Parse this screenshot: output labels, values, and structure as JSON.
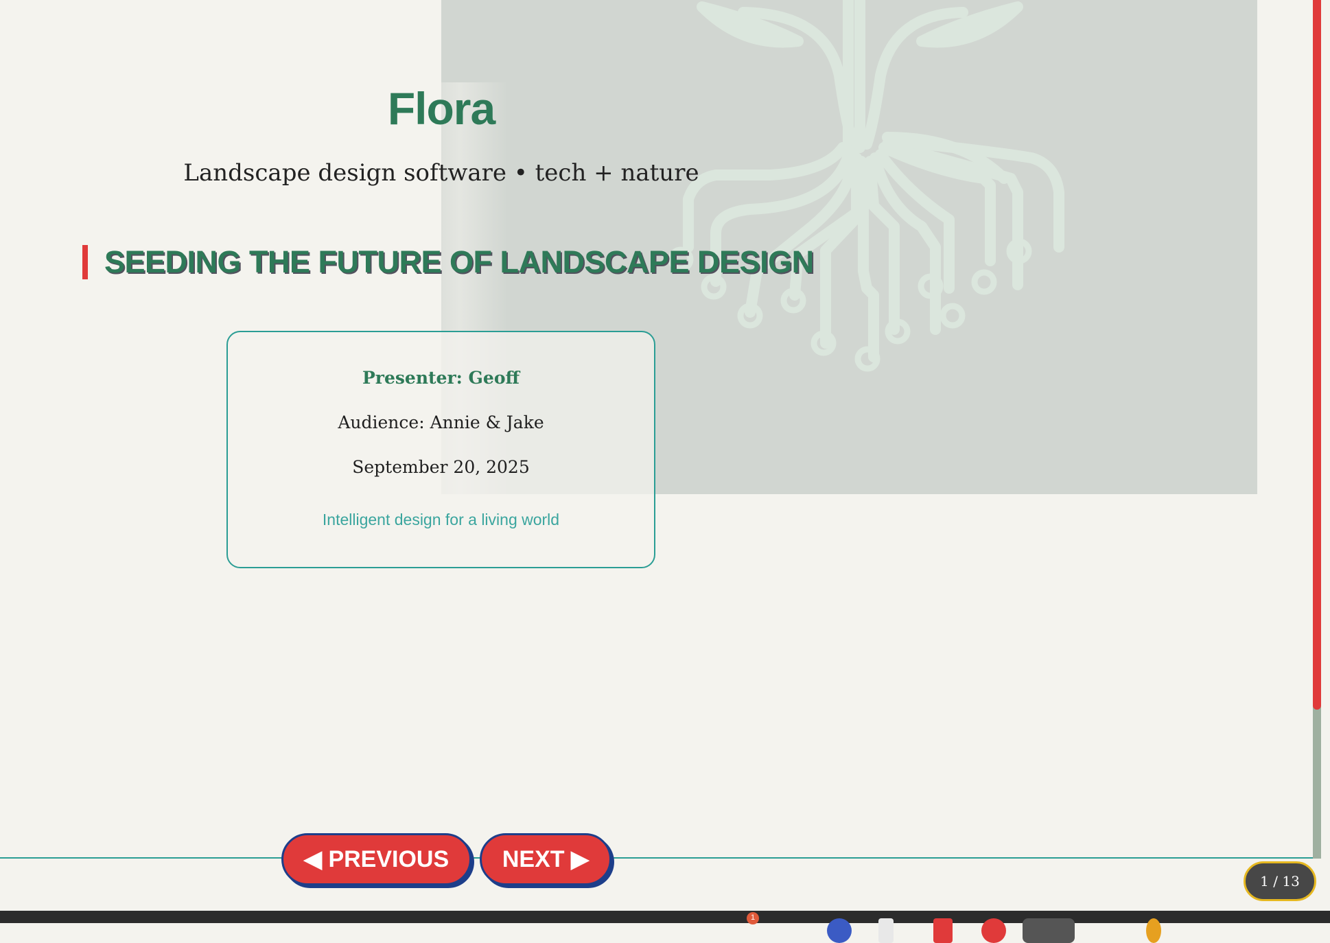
{
  "slide": {
    "brand": "Flora",
    "tagline": "Landscape design software • tech + nature",
    "section_heading": "SEEDING THE FUTURE OF LANDSCAPE DESIGN",
    "card": {
      "presenter": "Presenter: Geoff",
      "audience": "Audience: Annie & Jake",
      "date": "September 20, 2025",
      "motto": "Intelligent design for a living world"
    }
  },
  "navigation": {
    "previous_label": "◀ PREVIOUS",
    "next_label": "NEXT ▶",
    "page_indicator": "1 / 13"
  },
  "taskbar": {
    "badge_count": "1"
  },
  "colors": {
    "brand_green": "#2e7a58",
    "accent_red": "#e03a3a",
    "teal": "#2a9d94",
    "navy": "#1d3e8a",
    "background": "#f4f3ee",
    "hero_panel": "#d1d6d1"
  },
  "icons": {
    "hero_illustration": "circuit-tree-icon"
  }
}
